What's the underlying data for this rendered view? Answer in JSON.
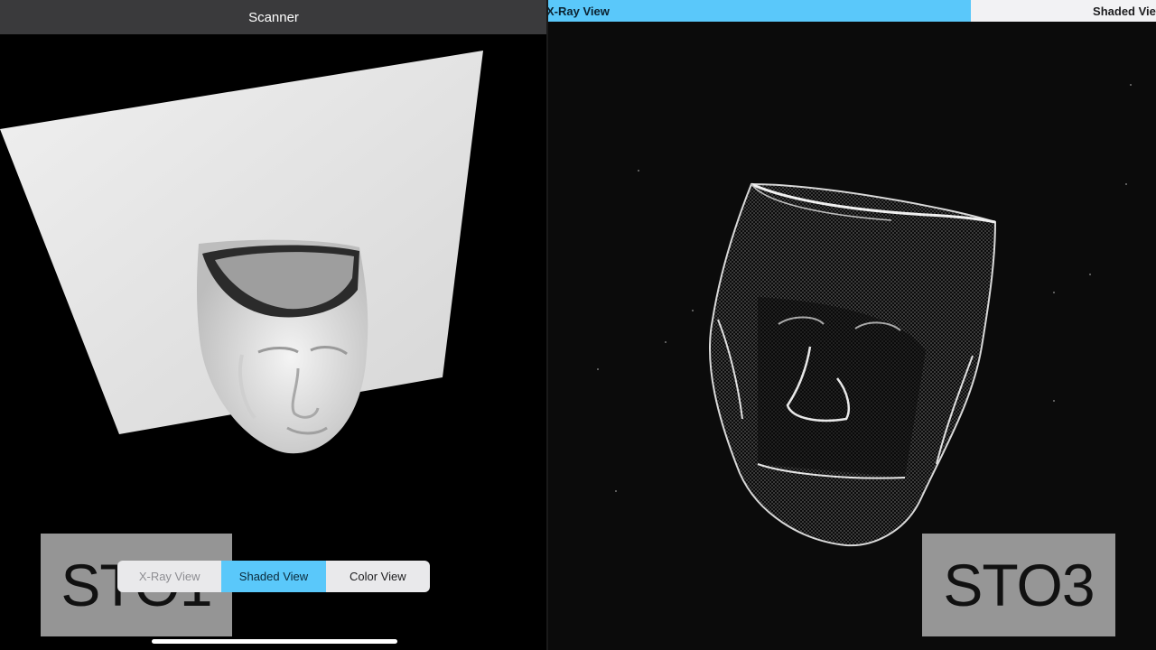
{
  "left": {
    "title": "Scanner",
    "segments": [
      {
        "label": "X-Ray View",
        "selected": false
      },
      {
        "label": "Shaded View",
        "selected": true
      },
      {
        "label": "Color View",
        "selected": false
      }
    ],
    "overlay_label": "STO1"
  },
  "right": {
    "tabs": [
      {
        "label": "X-Ray View",
        "selected": true
      },
      {
        "label": "Shaded View",
        "selected": false
      }
    ],
    "overlay_label": "STO3"
  },
  "colors": {
    "accent": "#5ac8fa",
    "nav_bar": "#3a3a3c",
    "scan_surface": "#e6e6e6",
    "overlay_box": "#aaaaaa"
  },
  "icons": {
    "left_model": "shaded-face-scan",
    "right_model": "xray-wireframe-face-scan"
  }
}
